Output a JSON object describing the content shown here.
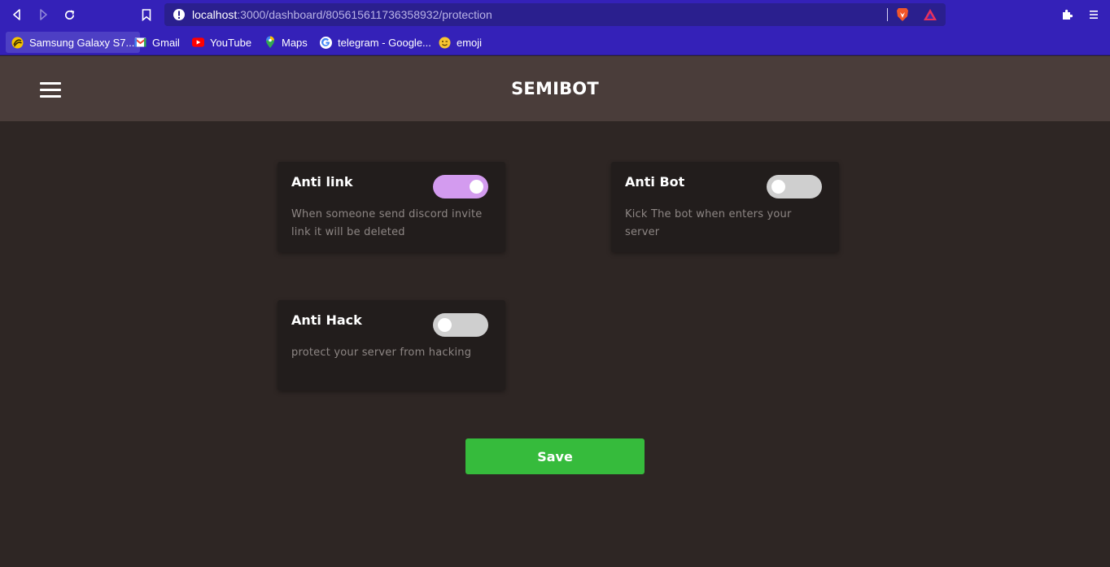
{
  "browser": {
    "url_host": "localhost",
    "url_path": ":3000/dashboard/805615611736358932/protection",
    "bookmarks": [
      {
        "label": "Samsung Galaxy S7...",
        "icon": "samsung-favicon"
      },
      {
        "label": "Gmail",
        "icon": "gmail-favicon"
      },
      {
        "label": "YouTube",
        "icon": "youtube-favicon"
      },
      {
        "label": "Maps",
        "icon": "maps-favicon"
      },
      {
        "label": "telegram - Google...",
        "icon": "google-favicon"
      },
      {
        "label": "emoji",
        "icon": "emoji-favicon"
      }
    ]
  },
  "header": {
    "brand": "SEMIBOT",
    "menu_icon": "hamburger-menu-icon"
  },
  "protections": [
    {
      "title": "Anti link",
      "description": "When someone send discord invite link it will be deleted",
      "enabled": true
    },
    {
      "title": "Anti Bot",
      "description": "Kick The bot when enters your server",
      "enabled": false
    },
    {
      "title": "Anti Hack",
      "description": "protect your server from hacking",
      "enabled": false
    }
  ],
  "save_label": "Save",
  "colors": {
    "toggle_on": "#d39bef",
    "toggle_off": "#cfcfcf",
    "save": "#36bb3c",
    "header": "#4a3d3a",
    "background": "#2e2624",
    "browser_chrome": "#3421b8"
  }
}
